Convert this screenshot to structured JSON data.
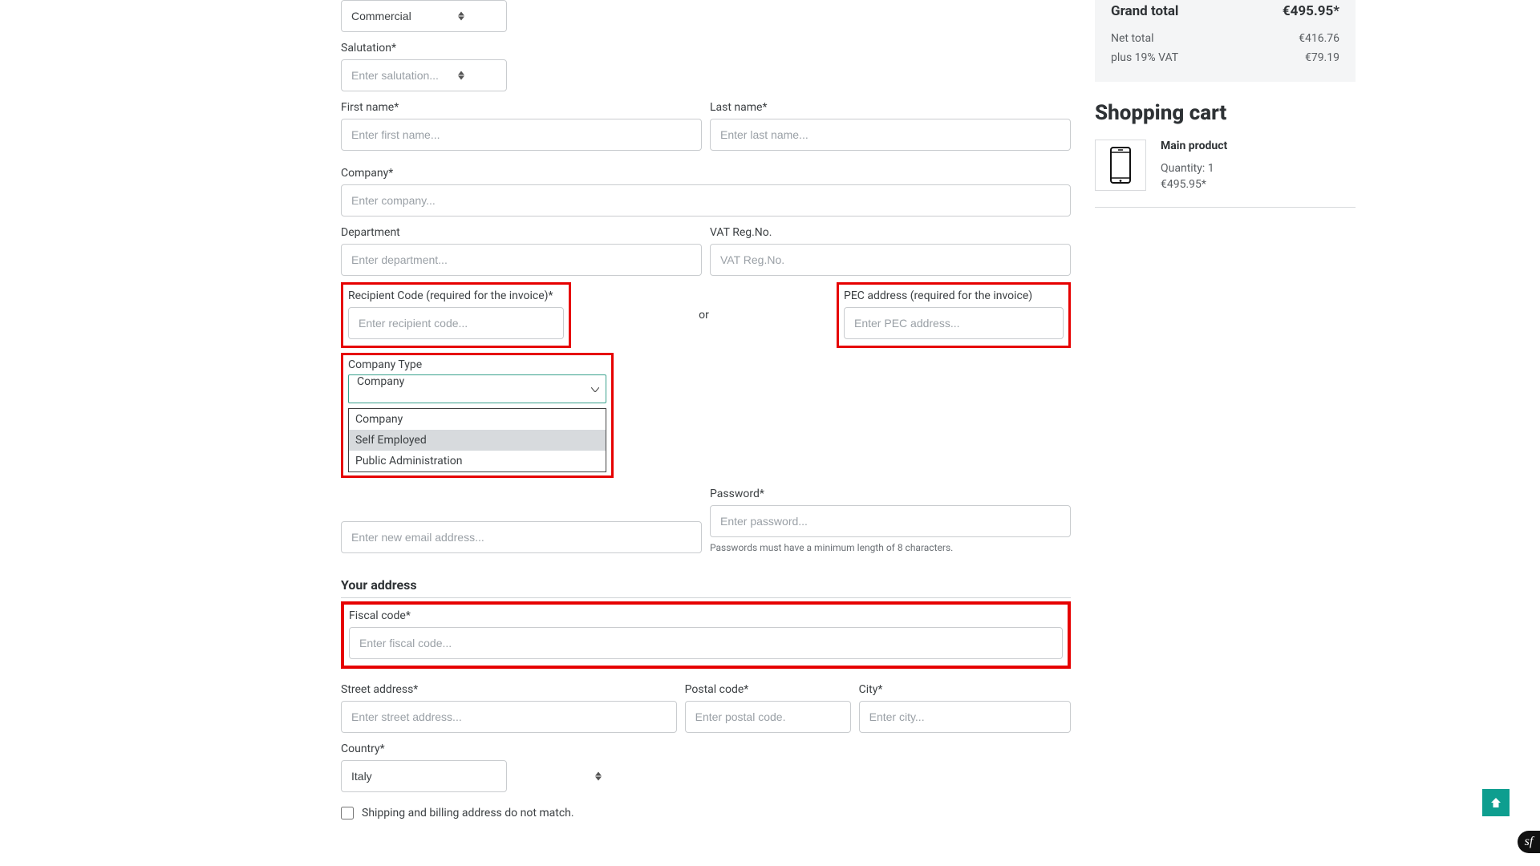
{
  "form": {
    "iam": {
      "label": "I am",
      "value": "Commercial"
    },
    "salutation": {
      "label": "Salutation*",
      "placeholder": "Enter salutation..."
    },
    "first_name": {
      "label": "First name*",
      "placeholder": "Enter first name..."
    },
    "last_name": {
      "label": "Last name*",
      "placeholder": "Enter last name..."
    },
    "company": {
      "label": "Company*",
      "placeholder": "Enter company..."
    },
    "department": {
      "label": "Department",
      "placeholder": "Enter department..."
    },
    "vat": {
      "label": "VAT Reg.No.",
      "placeholder": "VAT Reg.No."
    },
    "recipient_code": {
      "label": "Recipient Code (required for the invoice)*",
      "placeholder": "Enter recipient code..."
    },
    "or_text": "or",
    "pec": {
      "label": "PEC address (required for the invoice)",
      "placeholder": "Enter PEC address..."
    },
    "company_type": {
      "label": "Company Type",
      "selected": "Company",
      "options": [
        "Company",
        "Self Employed",
        "Public Administration"
      ],
      "hovered_index": 1
    },
    "email": {
      "placeholder": "Enter new email address..."
    },
    "password": {
      "label": "Password*",
      "placeholder": "Enter password...",
      "help": "Passwords must have a minimum length of 8 characters."
    },
    "address_heading": "Your address",
    "fiscal": {
      "label": "Fiscal code*",
      "placeholder": "Enter fiscal code..."
    },
    "street": {
      "label": "Street address*",
      "placeholder": "Enter street address..."
    },
    "postal": {
      "label": "Postal code*",
      "placeholder": "Enter postal code."
    },
    "city": {
      "label": "City*",
      "placeholder": "Enter city..."
    },
    "country": {
      "label": "Country*",
      "value": "Italy"
    },
    "ship_bill_diff": "Shipping and billing address do not match."
  },
  "summary": {
    "grand_label": "Grand total",
    "grand_value": "€495.95*",
    "net_label": "Net total",
    "net_value": "€416.76",
    "vat_label": "plus 19% VAT",
    "vat_value": "€79.19"
  },
  "cart": {
    "title": "Shopping cart",
    "item": {
      "name": "Main product",
      "qty": "Quantity: 1",
      "price": "€495.95*"
    }
  },
  "badge": "sf"
}
